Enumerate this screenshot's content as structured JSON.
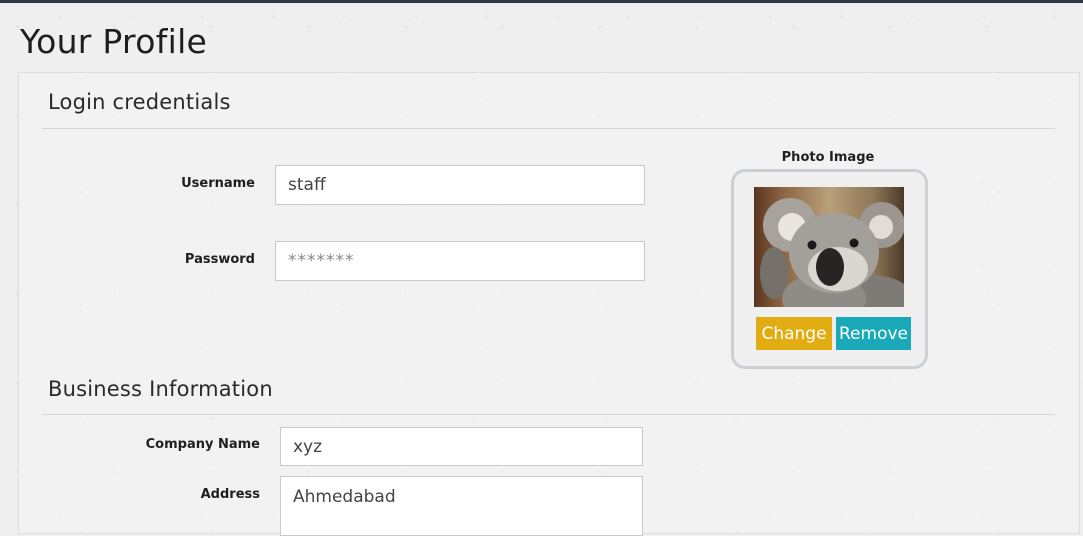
{
  "page": {
    "title": "Your Profile"
  },
  "login": {
    "heading": "Login credentials",
    "username": {
      "label": "Username",
      "value": "staff"
    },
    "password": {
      "label": "Password",
      "placeholder": "*******"
    }
  },
  "photo": {
    "label": "Photo Image",
    "alt": "Koala",
    "change_label": "Change",
    "remove_label": "Remove"
  },
  "business": {
    "heading": "Business Information",
    "company": {
      "label": "Company Name",
      "value": "xyz"
    },
    "address": {
      "label": "Address",
      "value": "Ahmedabad"
    }
  },
  "colors": {
    "change_button": "#e1ad13",
    "remove_button": "#19a9b9",
    "top_bar": "#2f3a45"
  }
}
